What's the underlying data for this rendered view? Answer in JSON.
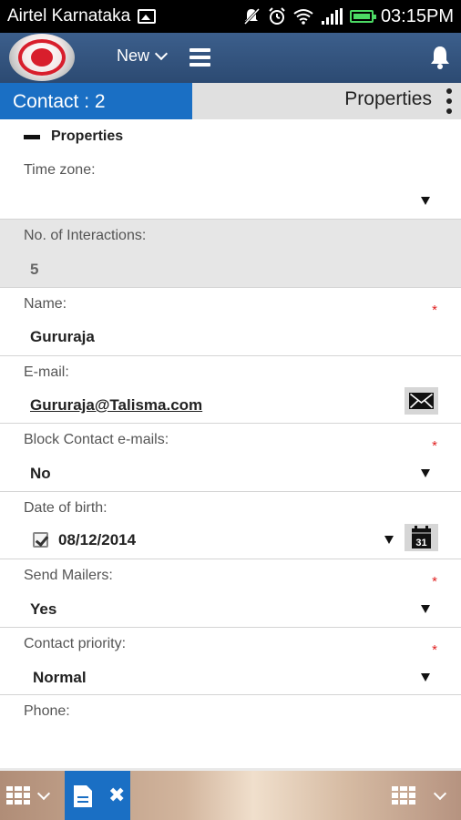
{
  "status_bar": {
    "carrier": "Airtel Karnataka",
    "time": "03:15PM",
    "icons": [
      "gallery-icon",
      "muted-notifications-icon",
      "alarm-icon",
      "wifi-icon",
      "signal-icon",
      "battery-icon"
    ]
  },
  "header": {
    "new_label": "New",
    "icons": [
      "app-logo",
      "chevron-down-icon",
      "menu-icon",
      "bell-icon"
    ]
  },
  "tabs": {
    "contact_label": "Contact : 2",
    "properties_label": "Properties"
  },
  "section": {
    "title": "Properties"
  },
  "fields": {
    "timezone": {
      "label": "Time zone:",
      "value": ""
    },
    "interactions": {
      "label": "No. of Interactions:",
      "value": "5"
    },
    "name": {
      "label": "Name:",
      "value": "Gururaja",
      "required": "*"
    },
    "email": {
      "label": "E-mail:",
      "value": "Gururaja@Talisma.com"
    },
    "block_emails": {
      "label": "Block Contact e-mails:",
      "value": "No",
      "required": "*"
    },
    "dob": {
      "label": "Date of birth:",
      "value": "08/12/2014",
      "calendar_day": "31"
    },
    "send_mailers": {
      "label": "Send Mailers:",
      "value": "Yes",
      "required": "*"
    },
    "priority": {
      "label": "Contact priority:",
      "value": "Normal",
      "required": "*"
    },
    "phone": {
      "label": "Phone:",
      "value": ""
    }
  },
  "colors": {
    "primary": "#1a6fc4",
    "header": "#2c4a72",
    "required": "#e02020"
  }
}
